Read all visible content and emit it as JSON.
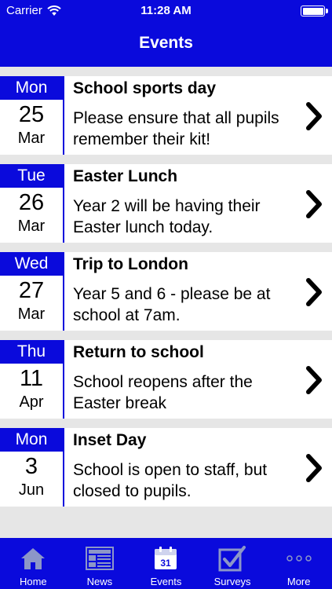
{
  "status": {
    "carrier": "Carrier",
    "time": "11:28 AM"
  },
  "nav": {
    "title": "Events"
  },
  "events": [
    {
      "dow": "Mon",
      "day": "25",
      "month": "Mar",
      "title": "School sports day",
      "desc": "Please ensure that all pupils remember their kit!"
    },
    {
      "dow": "Tue",
      "day": "26",
      "month": "Mar",
      "title": "Easter Lunch",
      "desc": "Year 2 will be having their Easter lunch today."
    },
    {
      "dow": "Wed",
      "day": "27",
      "month": "Mar",
      "title": "Trip to London",
      "desc": "Year 5 and 6 - please be at school at 7am."
    },
    {
      "dow": "Thu",
      "day": "11",
      "month": "Apr",
      "title": "Return to school",
      "desc": "School reopens after the Easter break"
    },
    {
      "dow": "Mon",
      "day": "3",
      "month": "Jun",
      "title": "Inset Day",
      "desc": "School is open to staff, but closed to pupils."
    }
  ],
  "tabs": [
    {
      "label": "Home",
      "icon": "home-icon"
    },
    {
      "label": "News",
      "icon": "news-icon"
    },
    {
      "label": "Events",
      "icon": "calendar-icon",
      "badge": "31"
    },
    {
      "label": "Surveys",
      "icon": "checkbox-icon"
    },
    {
      "label": "More",
      "icon": "more-icon"
    }
  ],
  "colors": {
    "accent": "#0a0adc",
    "background": "#e6e6e6",
    "tab_icon": "#8c96c8"
  }
}
